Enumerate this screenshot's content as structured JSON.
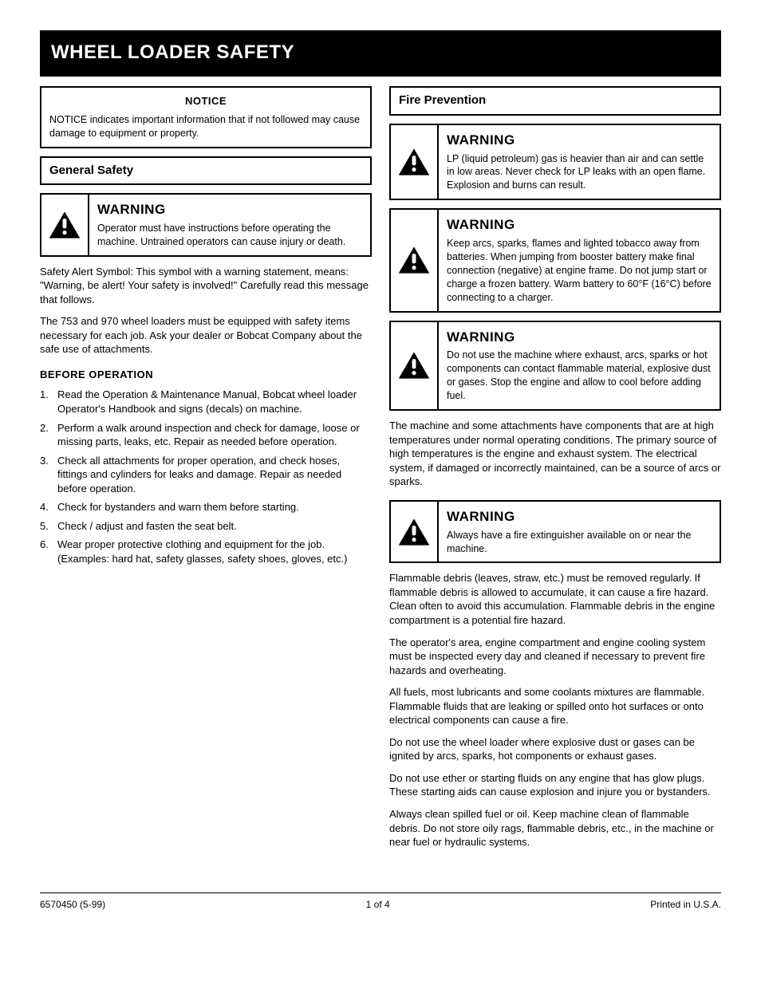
{
  "title": "WHEEL LOADER SAFETY",
  "left": {
    "notice": {
      "heading": "NOTICE",
      "body": "NOTICE indicates important information that if not followed may cause damage to equipment or property."
    },
    "general_header": "General Safety",
    "general_warn": {
      "level": "WARNING",
      "text": "Operator must have instructions before operating the machine. Untrained operators can cause injury or death."
    },
    "para1": "Safety Alert Symbol: This symbol with a warning statement, means: \"Warning, be alert! Your safety is involved!\" Carefully read this message that follows.",
    "para2": "The 753 and 970 wheel loaders must be equipped with safety items necessary for each job. Ask your dealer or Bobcat Company about the safe use of attachments.",
    "before": {
      "heading": "BEFORE OPERATION",
      "l1": "Read the Operation & Maintenance Manual, Bobcat wheel loader Operator's Handbook and signs (decals) on machine.",
      "l2": "Perform a walk around inspection and check for damage, loose or missing parts, leaks, etc. Repair as needed before operation.",
      "l3": "Check all attachments for proper operation, and check hoses, fittings and cylinders for leaks and damage. Repair as needed before operation.",
      "l4": "Check for bystanders and warn them before starting.",
      "l5": "Check / adjust and fasten the seat belt.",
      "l6": "Wear proper protective clothing and equipment for the job. (Examples: hard hat, safety glasses, safety shoes, gloves, etc.)"
    }
  },
  "right": {
    "fire_header": "Fire Prevention",
    "w1": {
      "level": "WARNING",
      "text": "LP (liquid petroleum) gas is heavier than air and can settle in low areas. Never check for LP leaks with an open flame. Explosion and burns can result."
    },
    "w2": {
      "level": "WARNING",
      "text": "Keep arcs, sparks, flames and lighted tobacco away from batteries. When jumping from booster battery make final connection (negative) at engine frame. Do not jump start or charge a frozen battery. Warm battery to 60°F (16°C) before connecting to a charger."
    },
    "w3": {
      "level": "WARNING",
      "text": "Do not use the machine where exhaust, arcs, sparks or hot components can contact flammable material, explosive dust or gases. Stop the engine and allow to cool before adding fuel."
    },
    "para1": "The machine and some attachments have components that are at high temperatures under normal operating conditions. The primary source of high temperatures is the engine and exhaust system. The electrical system, if damaged or incorrectly maintained, can be a source of arcs or sparks.",
    "w4": {
      "level": "WARNING",
      "text": "Always have a fire extinguisher available on or near the machine."
    },
    "para2": "Flammable debris (leaves, straw, etc.) must be removed regularly. If flammable debris is allowed to accumulate, it can cause a fire hazard. Clean often to avoid this accumulation. Flammable debris in the engine compartment is a potential fire hazard.",
    "para3": "The operator's area, engine compartment and engine cooling system must be inspected every day and cleaned if necessary to prevent fire hazards and overheating.",
    "para4": "All fuels, most lubricants and some coolants mixtures are flammable. Flammable fluids that are leaking or spilled onto hot surfaces or onto electrical components can cause a fire.",
    "para5": "Do not use the wheel loader where explosive dust or gases can be ignited by arcs, sparks, hot components or exhaust gases.",
    "para6": "Do not use ether or starting fluids on any engine that has glow plugs. These starting aids can cause explosion and injure you or bystanders.",
    "para7": "Always clean spilled fuel or oil. Keep machine clean of flammable debris. Do not store oily rags, flammable debris, etc., in the machine or near fuel or hydraulic systems."
  },
  "footer": {
    "left": "6570450 (5-99)",
    "center": "1 of 4",
    "right": "Printed in U.S.A."
  }
}
